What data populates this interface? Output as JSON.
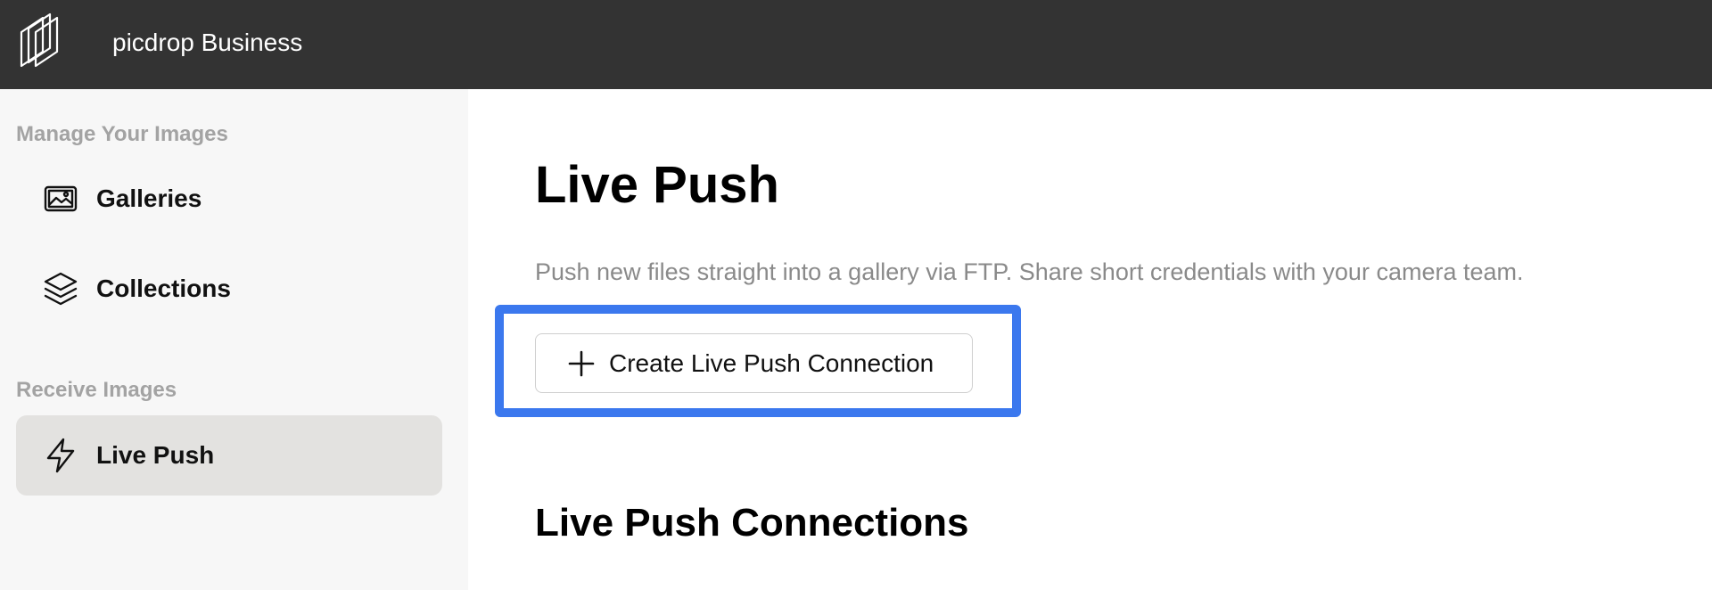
{
  "app": {
    "brand": "picdrop Business",
    "logo_icon": "picdrop-logo-icon"
  },
  "sidebar": {
    "sections": [
      {
        "label": "Manage Your Images",
        "items": [
          {
            "label": "Galleries",
            "icon": "gallery-icon",
            "active": false
          },
          {
            "label": "Collections",
            "icon": "layers-icon",
            "active": false
          }
        ]
      },
      {
        "label": "Receive Images",
        "items": [
          {
            "label": "Live Push",
            "icon": "lightning-icon",
            "active": true
          }
        ]
      }
    ]
  },
  "main": {
    "title": "Live Push",
    "description": "Push new files straight into a gallery via FTP. Share short credentials with your camera team.",
    "create_button": {
      "label": "Create Live Push Connection",
      "icon": "plus-icon"
    },
    "connections_title": "Live Push Connections"
  },
  "colors": {
    "topbar": "#333333",
    "sidebar": "#f7f7f7",
    "active_item": "#e3e2e0",
    "highlight": "#3b78ee"
  }
}
